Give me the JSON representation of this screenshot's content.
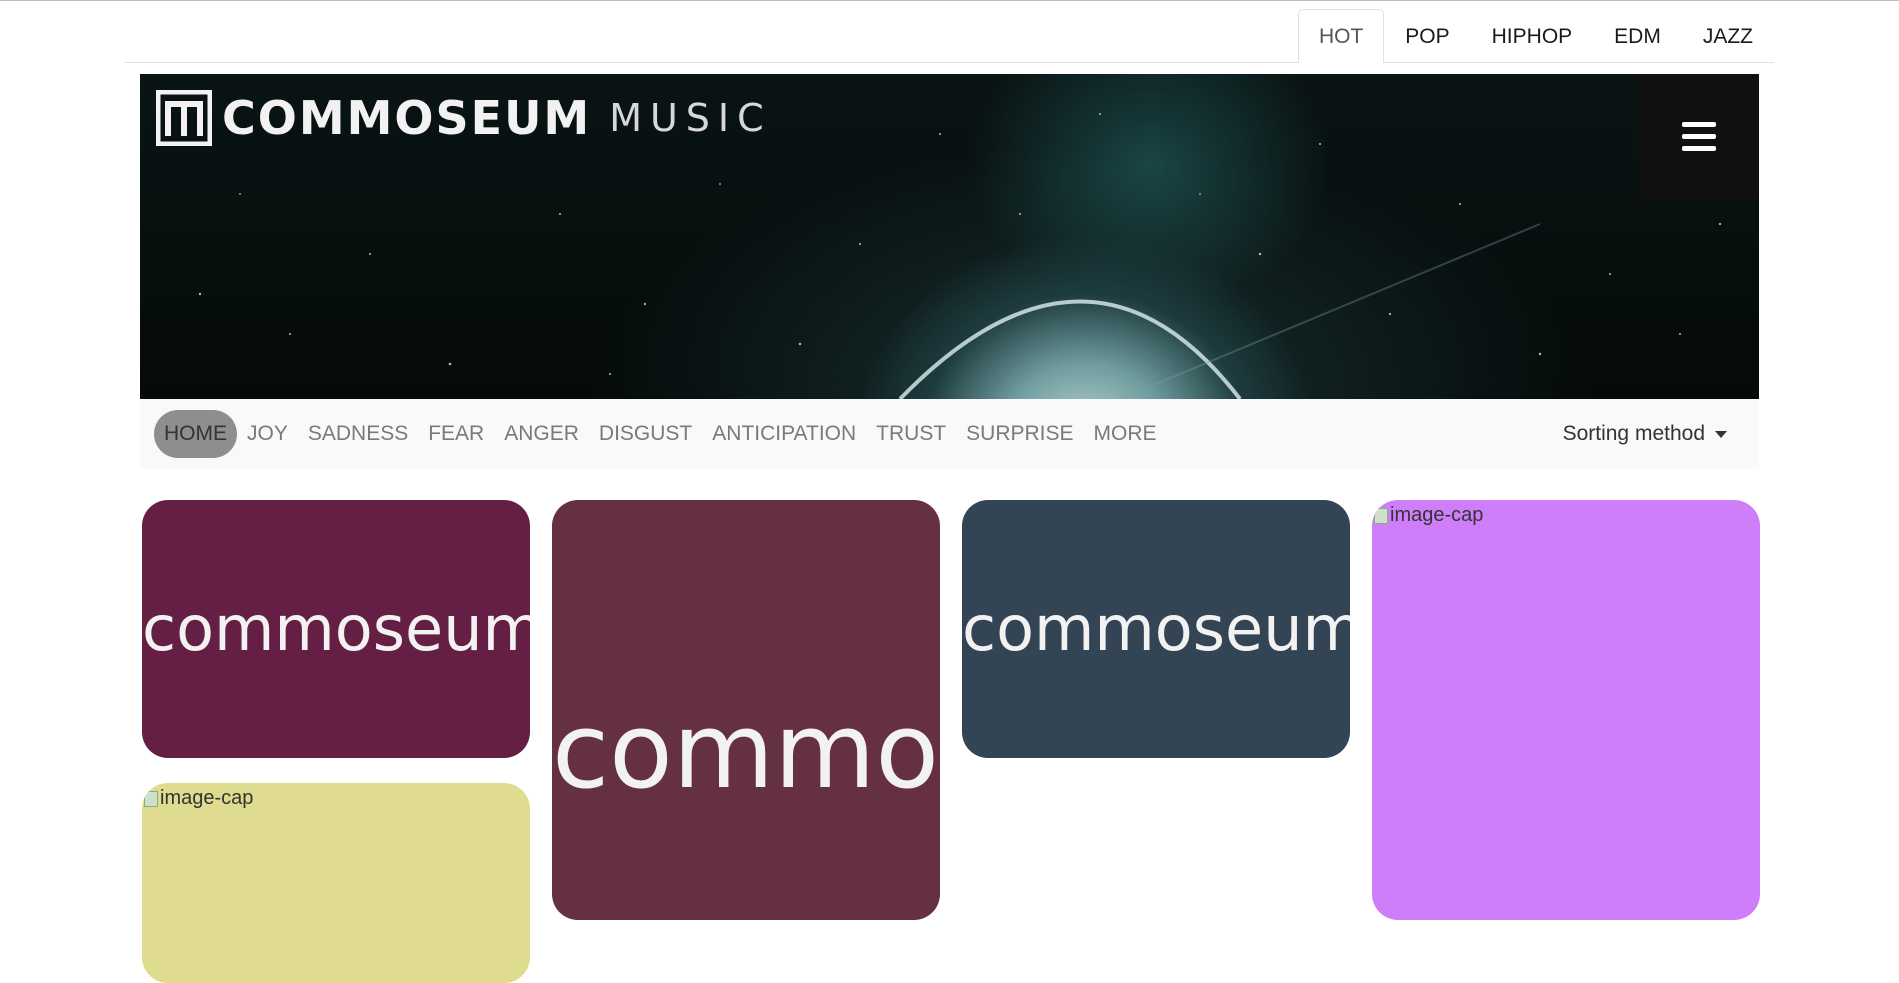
{
  "genre_tabs": [
    {
      "label": "HOT",
      "active": true
    },
    {
      "label": "POP",
      "active": false
    },
    {
      "label": "HIPHOP",
      "active": false
    },
    {
      "label": "EDM",
      "active": false
    },
    {
      "label": "JAZZ",
      "active": false
    }
  ],
  "banner": {
    "logo_word": "COMMOSEUM",
    "logo_sub": "MUSIC",
    "menu_icon": "hamburger-menu-icon"
  },
  "emotion_nav": {
    "items": [
      "HOME",
      "JOY",
      "SADNESS",
      "FEAR",
      "ANGER",
      "DISGUST",
      "ANTICIPATION",
      "TRUST",
      "SURPRISE",
      "MORE"
    ],
    "active": "HOME",
    "sort_label": "Sorting method"
  },
  "cards": [
    {
      "text": "commoseum",
      "color": "#661f44"
    },
    {
      "text": "commoseum",
      "color": "#663043"
    },
    {
      "text": "commoseum",
      "color": "#334455"
    },
    {
      "alt": "image-cap",
      "color": "#cf7efa"
    },
    {
      "alt": "image-cap",
      "color": "#dfdb8f"
    }
  ]
}
